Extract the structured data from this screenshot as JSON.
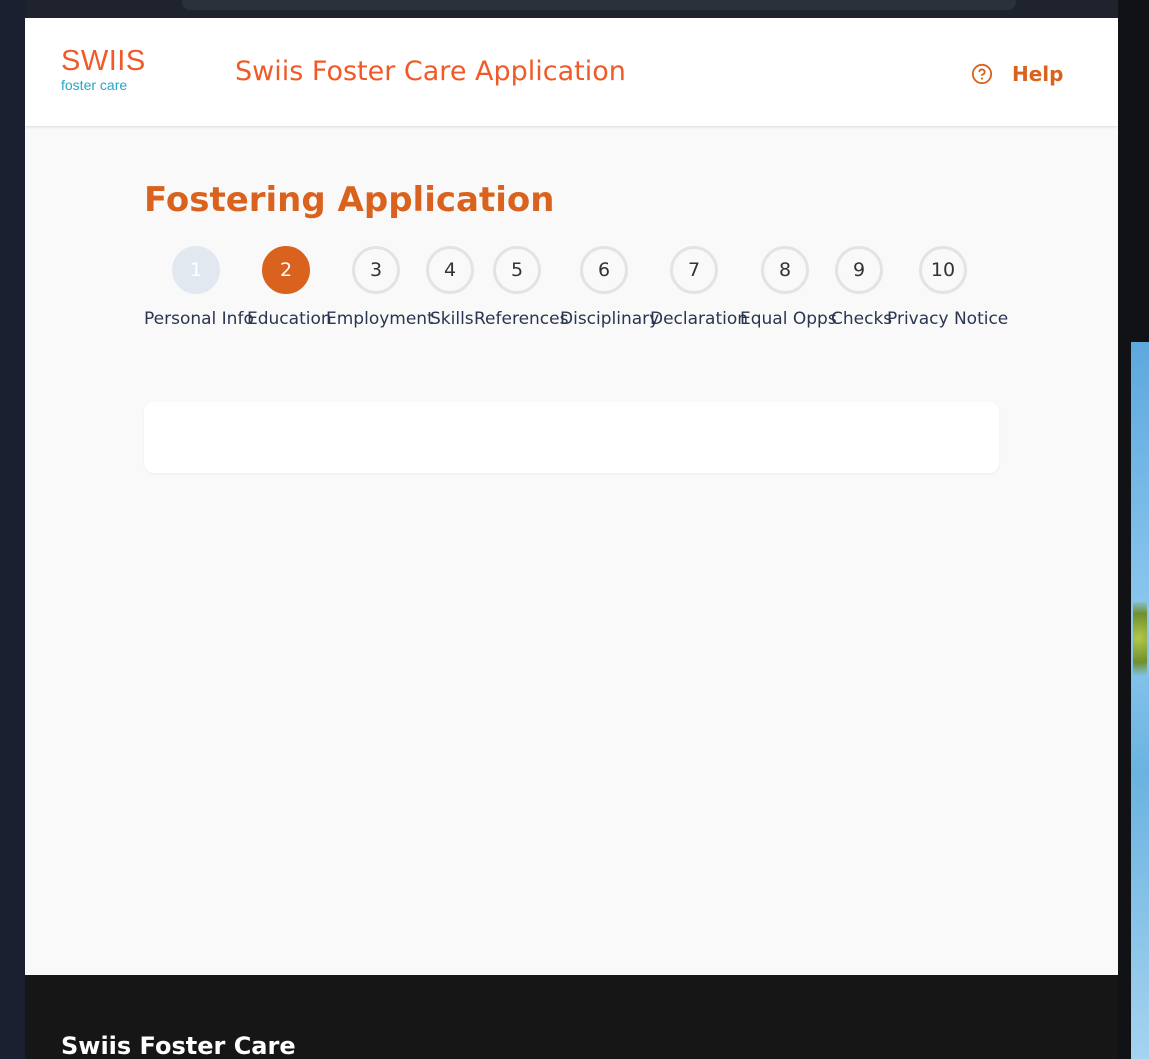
{
  "header": {
    "logo_main": "SWIIS",
    "logo_sub": "foster care",
    "app_title": "Swiis Foster Care Application",
    "help_label": "Help",
    "help_icon": "question-circle-icon"
  },
  "page_title": "Fostering Application",
  "current_step": 2,
  "steps": [
    {
      "number": "1",
      "label": "Personal Info",
      "state": "completed"
    },
    {
      "number": "2",
      "label": "Education",
      "state": "active"
    },
    {
      "number": "3",
      "label": "Employment",
      "state": "pending"
    },
    {
      "number": "4",
      "label": "Skills",
      "state": "pending"
    },
    {
      "number": "5",
      "label": "References",
      "state": "pending"
    },
    {
      "number": "6",
      "label": "Disciplinary",
      "state": "pending"
    },
    {
      "number": "7",
      "label": "Declaration",
      "state": "pending"
    },
    {
      "number": "8",
      "label": "Equal Opps",
      "state": "pending"
    },
    {
      "number": "9",
      "label": "Checks",
      "state": "pending"
    },
    {
      "number": "10",
      "label": "Privacy Notice",
      "state": "pending"
    }
  ],
  "footer": {
    "title": "Swiis Foster Care"
  },
  "colors": {
    "brand_orange": "#f05a28",
    "accent_orange": "#d9631e",
    "brand_teal": "#26a7c6",
    "completed_step": "#e2e8f0",
    "footer_bg": "#161616"
  }
}
